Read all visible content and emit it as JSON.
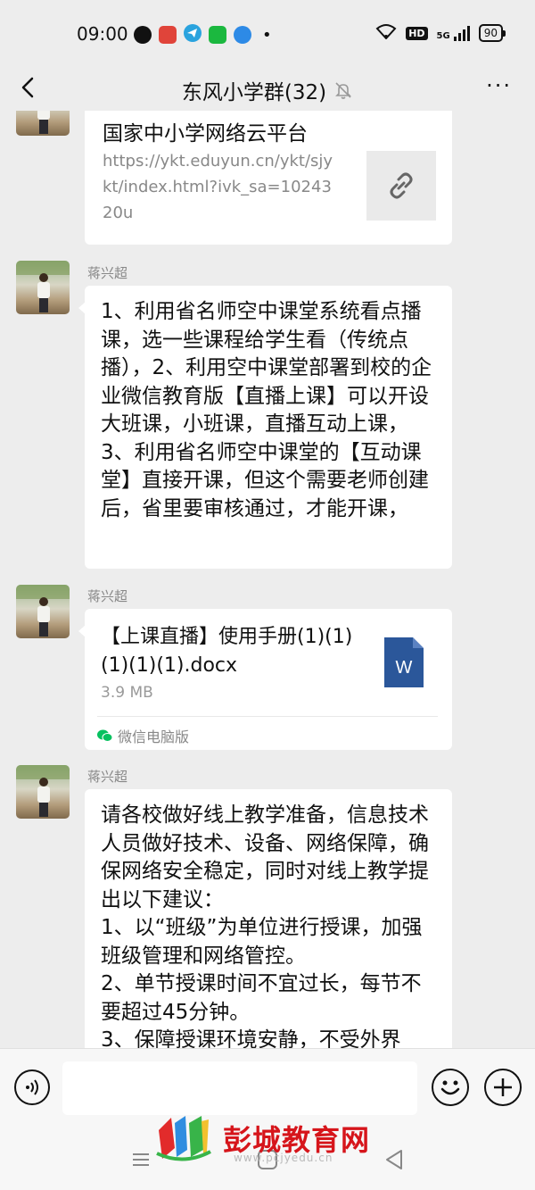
{
  "status_bar": {
    "time": "09:00",
    "network": "5G",
    "hd_badge": "HD",
    "battery": "90"
  },
  "nav": {
    "title": "东风小学群(32)",
    "more": "···"
  },
  "messages": [
    {
      "type": "link",
      "link_title": "国家中小学网络云平台",
      "link_url": "https://ykt.eduyun.cn/ykt/sjykt/index.html?ivk_sa=1024320u"
    },
    {
      "type": "text",
      "sender": "蒋兴超",
      "text": "1、利用省名师空中课堂系统看点播课，选一些课程给学生看（传统点播），2、利用空中课堂部署到校的企业微信教育版【直播上课】可以开设大班课，小班课，直播互动上课，3、利用省名师空中课堂的【互动课堂】直接开课，但这个需要老师创建后，省里要审核通过，才能开课，"
    },
    {
      "type": "file",
      "sender": "蒋兴超",
      "file_name": "【上课直播】使用手册(1)(1)(1)(1)(1).docx",
      "file_size": "3.9 MB",
      "file_icon_letter": "W",
      "source": "微信电脑版"
    },
    {
      "type": "text",
      "sender": "蒋兴超",
      "text": "请各校做好线上教学准备，信息技术人员做好技术、设备、网络保障，确保网络安全稳定，同时对线上教学提出以下建议：\n1、以“班级”为单位进行授课，加强班级管理和网络管控。\n2、单节授课时间不宜过长，每节不要超过45分钟。\n3、保障授课环境安静，不受外界"
    }
  ],
  "input": {
    "placeholder": ""
  },
  "watermark": {
    "text": "彭城教育网",
    "sub": "www.pcjyedu.cn"
  },
  "colors": {
    "background": "#ededed",
    "bubble": "#ffffff",
    "word_blue": "#2b579a",
    "watermark_red": "#d6151b"
  }
}
